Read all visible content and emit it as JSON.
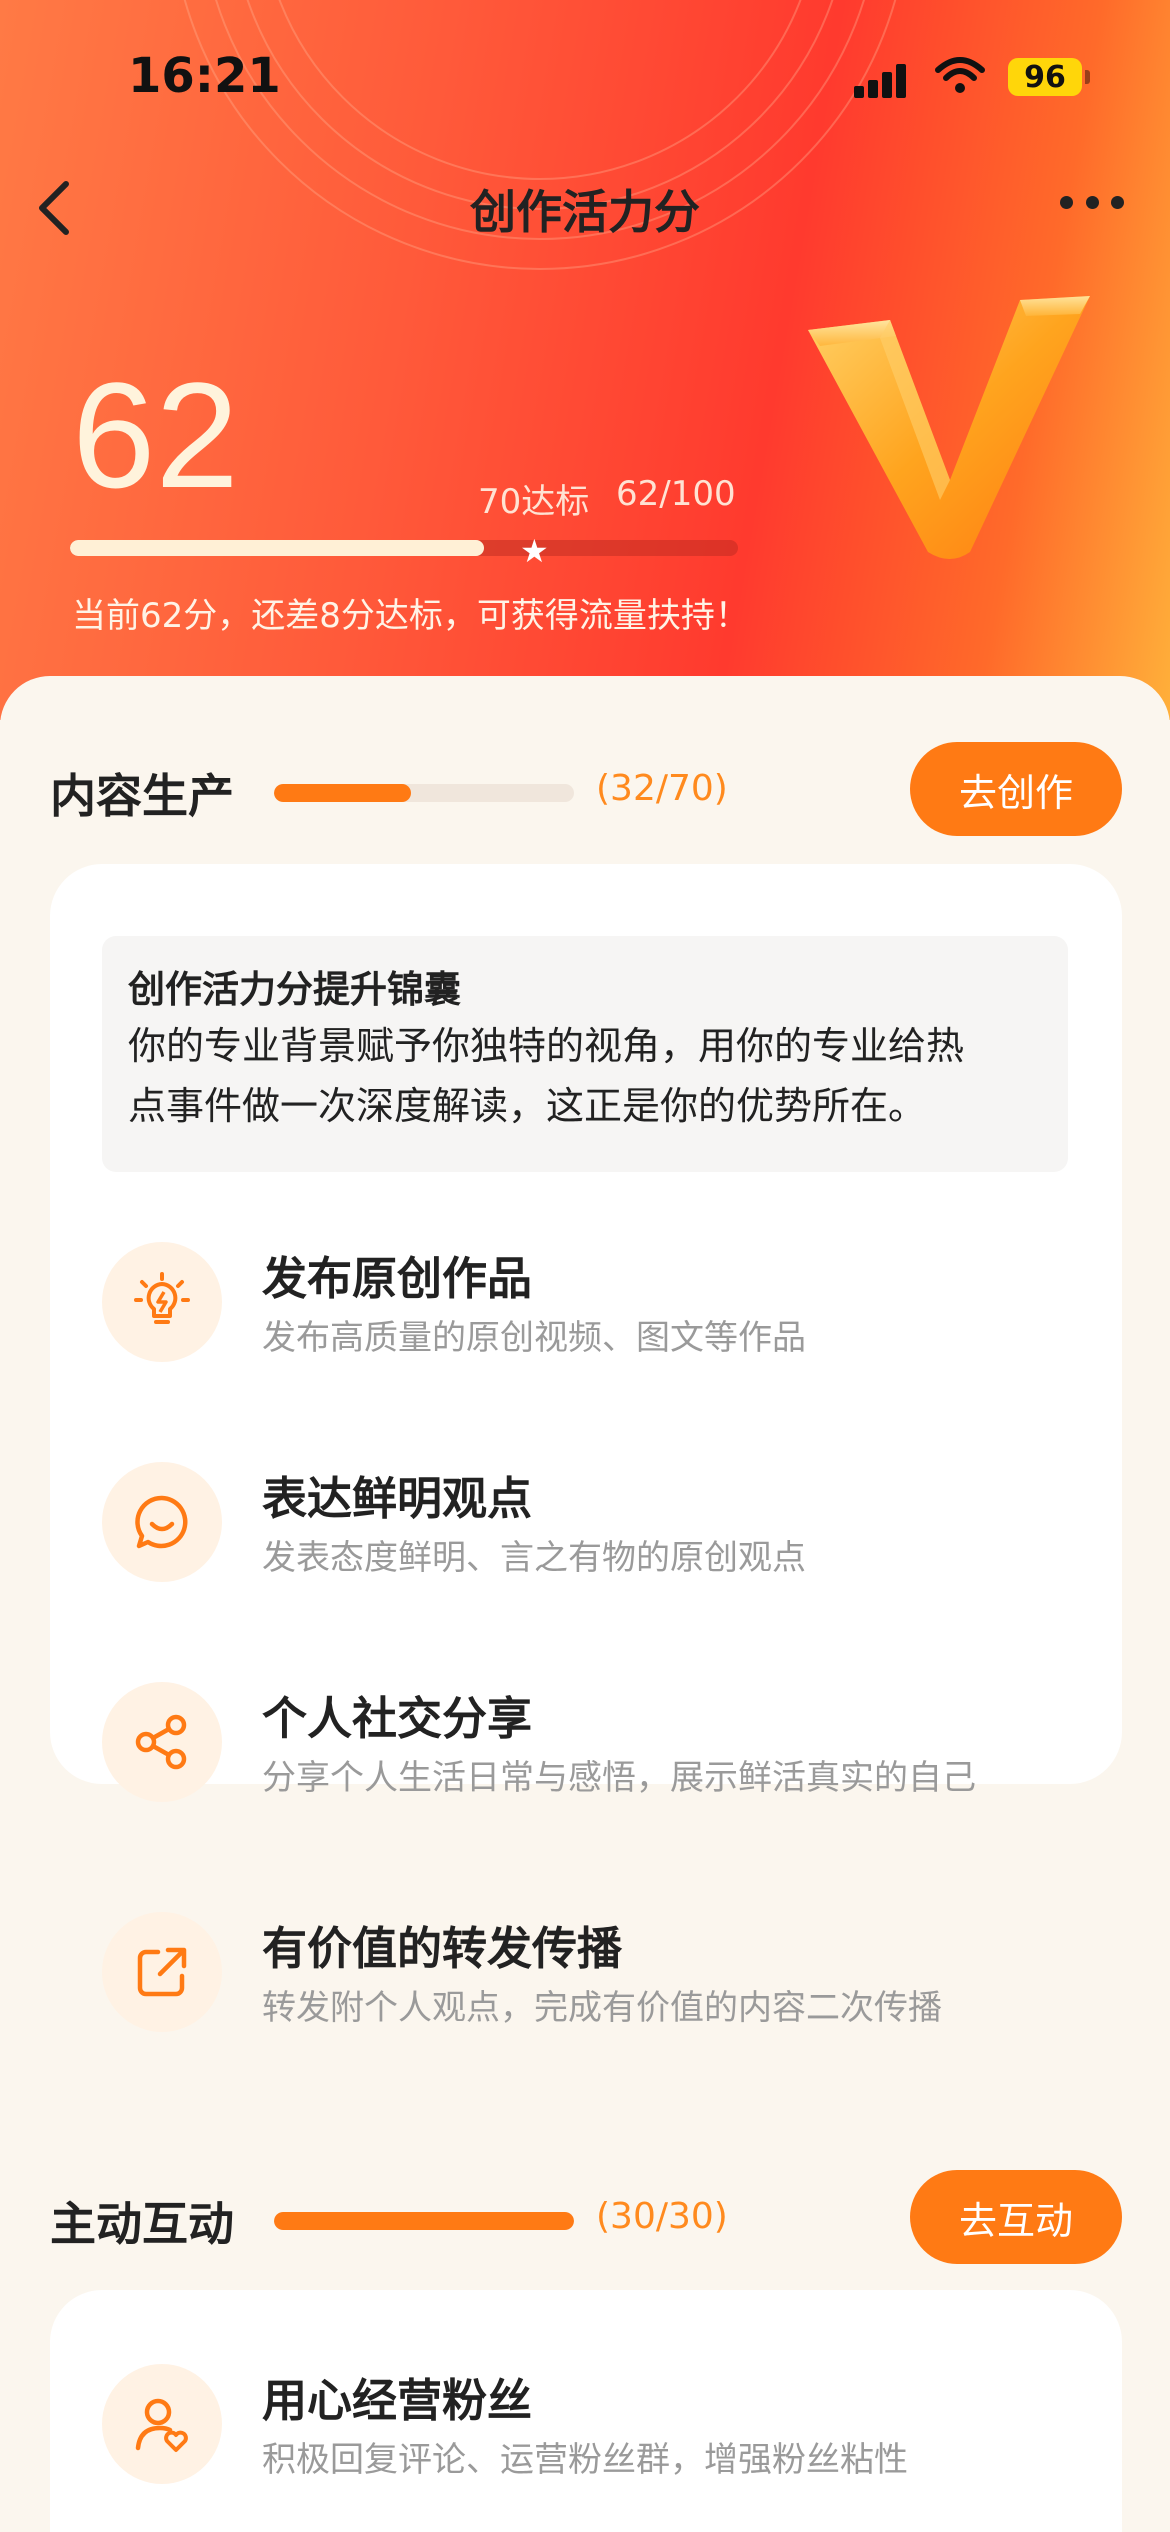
{
  "status": {
    "time": "16:21",
    "battery": "96"
  },
  "header": {
    "title": "创作活力分"
  },
  "score": {
    "value": "62",
    "target_label": "70达标",
    "fraction_label": "62/100",
    "progress_fraction": 0.62,
    "tip": "当前62分，还差8分达标，可获得流量扶持！"
  },
  "content_section": {
    "title": "内容生产",
    "count": "(32/70)",
    "progress_fraction": 0.457,
    "button": "去创作",
    "tip_title": "创作活力分提升锦囊",
    "tip_line1": "你的专业背景赋予你独特的视角，用你的专业给热",
    "tip_line2": "点事件做一次深度解读，这正是你的优势所在。",
    "items": [
      {
        "icon": "lightbulb-icon",
        "title": "发布原创作品",
        "desc": "发布高质量的原创视频、图文等作品"
      },
      {
        "icon": "chat-smile-icon",
        "title": "表达鲜明观点",
        "desc": "发表态度鲜明、言之有物的原创观点"
      },
      {
        "icon": "share-icon",
        "title": "个人社交分享",
        "desc": "分享个人生活日常与感悟，展示鲜活真实的自己"
      },
      {
        "icon": "forward-icon",
        "title": "有价值的转发传播",
        "desc": "转发附个人观点，完成有价值的内容二次传播"
      }
    ]
  },
  "interaction_section": {
    "title": "主动互动",
    "count": "(30/30)",
    "progress_fraction": 1.0,
    "button": "去互动",
    "items": [
      {
        "icon": "user-heart-icon",
        "title": "用心经营粉丝",
        "desc": "积极回复评论、运营粉丝群，增强粉丝粘性"
      }
    ]
  },
  "colors": {
    "accent": "#ff7a14",
    "hero_red": "#ff3a2e",
    "count_orange": "#ff8a1e"
  }
}
